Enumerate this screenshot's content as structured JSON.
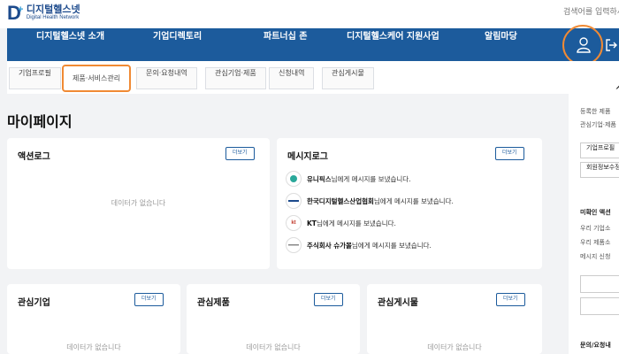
{
  "logo": {
    "mark": "D",
    "plus": "+",
    "name_kr": "디지털헬스넷",
    "name_en": "Digital Health Network"
  },
  "search": {
    "placeholder": "검색어를 입력하세요"
  },
  "nav": {
    "items": [
      "디지털헬스넷 소개",
      "기업디렉토리",
      "파트너십 존",
      "디지털헬스케어 지원사업",
      "알림마당"
    ]
  },
  "subtabs": {
    "items": [
      "기업프로필",
      "제품·서비스관리",
      "문의·요청내역",
      "관심기업·제품",
      "신청내역",
      "관심게시물"
    ],
    "active_index": 1
  },
  "page": {
    "title": "마이페이지"
  },
  "cards": {
    "action_log": {
      "title": "액션로그",
      "more": "더보기",
      "empty": "데이터가 없습니다"
    },
    "message_log": {
      "title": "메시지로그",
      "more": "더보기",
      "messages": [
        {
          "sender": "유니픽스",
          "text": "님에게 메시지를 보냈습니다.",
          "icon": "unipix-logo"
        },
        {
          "sender": "한국디지털헬스산업협회",
          "text": "님에게 메시지를 보냈습니다.",
          "icon": "khia-logo"
        },
        {
          "sender": "KT",
          "text": "님에게 메시지를 보냈습니다.",
          "icon": "kt-logo",
          "icon_text": "kt"
        },
        {
          "sender": "주식회사 슈가몰",
          "text": "님에게 메시지를 보냈습니다.",
          "icon": "sugarmall-logo"
        }
      ]
    },
    "interest_company": {
      "title": "관심기업",
      "more": "더보기",
      "empty": "데이터가 없습니다"
    },
    "interest_product": {
      "title": "관심제품",
      "more": "더보기",
      "empty": "데이터가 없습니다"
    },
    "interest_post": {
      "title": "관심게시물",
      "more": "더보기",
      "empty": "데이터가 없습니다"
    }
  },
  "right_panel": {
    "caret": "^",
    "line1": "등록한 제품",
    "line2": "관심기업·제품",
    "btn1": "기업프로필",
    "btn2": "회원정보수정",
    "section_title": "미확인 액션",
    "line3": "우리 기업소",
    "line4": "우리 제품소",
    "line5": "메시지 신청",
    "section2_title": "문의/요청내"
  },
  "colors": {
    "brand": "#1c5b9c",
    "highlight": "#f08a34"
  }
}
